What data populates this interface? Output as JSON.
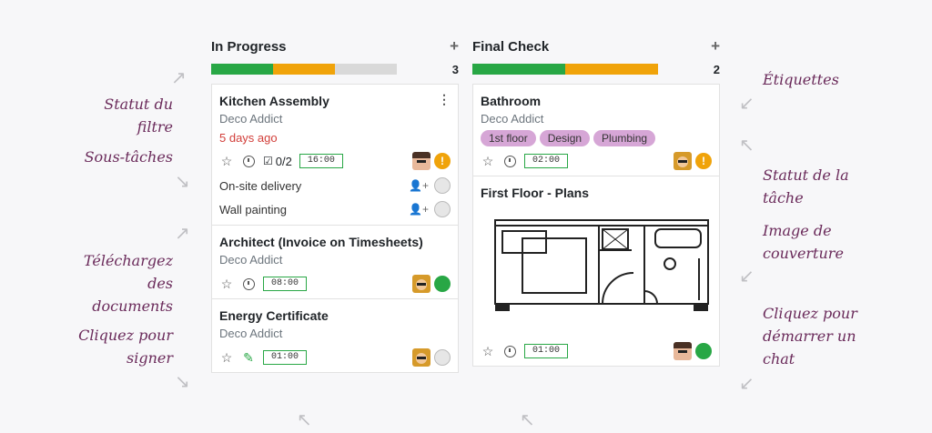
{
  "annotations": {
    "filter_status": "Statut du filtre",
    "subtasks": "Sous-tâches",
    "upload_docs_1": "Téléchargez des",
    "upload_docs_2": "documents",
    "click_sign_1": "Cliquez pour",
    "click_sign_2": "signer",
    "tags": "Étiquettes",
    "task_status_1": "Statut de la",
    "task_status_2": "tâche",
    "cover_image_1": "Image de",
    "cover_image_2": "couverture",
    "start_chat_1": "Cliquez pour",
    "start_chat_2": "démarrer un",
    "start_chat_3": "chat"
  },
  "columns": [
    {
      "title": "In Progress",
      "plus": "+",
      "count": "3",
      "progress": {
        "green": 0.33,
        "orange": 0.33,
        "grey": 0.34
      },
      "cards": [
        {
          "title": "Kitchen Assembly",
          "customer": "Deco Addict",
          "overdue": "5 days ago",
          "subtask_count": "0/2",
          "time": "16:00",
          "status": "orange",
          "subtasks": [
            {
              "label": "On-site delivery"
            },
            {
              "label": "Wall painting"
            }
          ]
        },
        {
          "title": "Architect (Invoice on Timesheets)",
          "customer": "Deco Addict",
          "time": "08:00",
          "status": "green"
        },
        {
          "title": "Energy Certificate",
          "customer": "Deco Addict",
          "time": "01:00",
          "status": "grey"
        }
      ]
    },
    {
      "title": "Final Check",
      "plus": "+",
      "count": "2",
      "progress": {
        "green": 0.5,
        "orange": 0.5,
        "grey": 0
      },
      "cards": [
        {
          "title": "Bathroom",
          "customer": "Deco Addict",
          "tags": [
            "1st floor",
            "Design",
            "Plumbing"
          ],
          "time": "02:00",
          "status": "orange"
        },
        {
          "title": "First Floor - Plans",
          "time": "01:00",
          "status": "green"
        }
      ]
    }
  ],
  "icons": {
    "star": "star-icon",
    "clock": "clock-icon",
    "checkbox": "checkbox-icon",
    "sign": "pen-icon",
    "kebab": "kebab-menu-icon",
    "assign": "person-plus-icon"
  },
  "colors": {
    "green": "#28a745",
    "orange": "#f0a30a",
    "grey": "#d9d9d9",
    "tag": "#d6a6d6",
    "overdue": "#d23f3a"
  }
}
